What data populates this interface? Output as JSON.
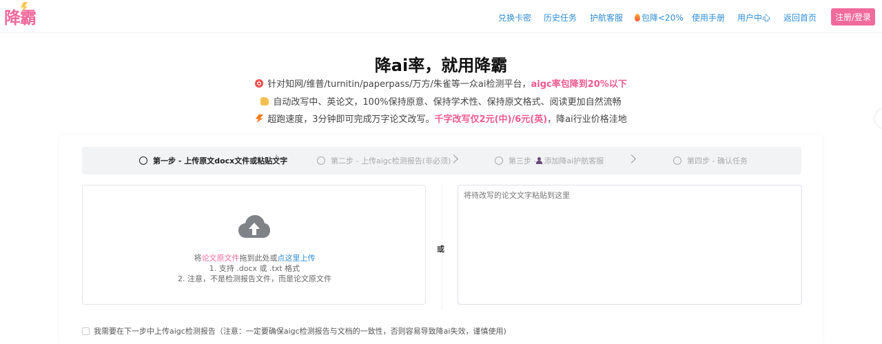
{
  "header": {
    "logo": "降霸",
    "nav": [
      {
        "label": "兑换卡密"
      },
      {
        "label": "历史任务"
      },
      {
        "label": "护航客服"
      },
      {
        "label": "包降<20%",
        "icon": "fire-icon"
      },
      {
        "label": "使用手册"
      },
      {
        "label": "用户中心"
      },
      {
        "label": "返回首页"
      }
    ],
    "login_label": "注册/登录"
  },
  "hero": {
    "title": "降ai率，就用降霸",
    "line1": {
      "icon": "target-icon",
      "text": "针对知网/维普/turnitin/paperpass/万方/朱雀等一众ai检测平台，",
      "emphasis": "aigc率包降到20%以下"
    },
    "line2": {
      "icon": "writing-hand-icon",
      "text": "自动改写中、英论文，100%保持原意、保持学术性、保持原文格式、阅读更加自然流畅"
    },
    "line3": {
      "icon": "lightning-icon",
      "text": "超跑速度，3分钟即可完成万字论文改写。",
      "emphasis": "千字改写仅2元(中)/6元(英)",
      "tail": "，降ai行业价格洼地"
    }
  },
  "steps": [
    {
      "label": "第一步 - 上传原文docx文件或粘贴文字",
      "active": true
    },
    {
      "label": "第二步 - 上传aigc检测报告(非必须)",
      "active": false
    },
    {
      "label": "第三步 - ",
      "extra": "添加降ai护航客服",
      "active": false
    },
    {
      "label": "第四步 - 确认任务",
      "active": false
    }
  ],
  "upload": {
    "prefix": "将",
    "file_link": "论文原文件",
    "middle": "拖到此处或",
    "click_link": "点这里上传",
    "note1": "1. 支持 .docx 或 .txt 格式",
    "note2": "2. 注意，不是检测报告文件，而是论文原文件"
  },
  "or_label": "或",
  "textarea": {
    "placeholder": "将待改写的论文文字粘贴到这里"
  },
  "checkbox": {
    "label": "我需要在下一步中上传aigc检测报告（注意：一定要确保aigc检测报告与文档的一致性，否则容易导致降ai失效，谨慎使用)"
  },
  "colors": {
    "accent": "#f06a9c",
    "link": "#2f8fd8",
    "emphasis": "#f05a8e"
  }
}
